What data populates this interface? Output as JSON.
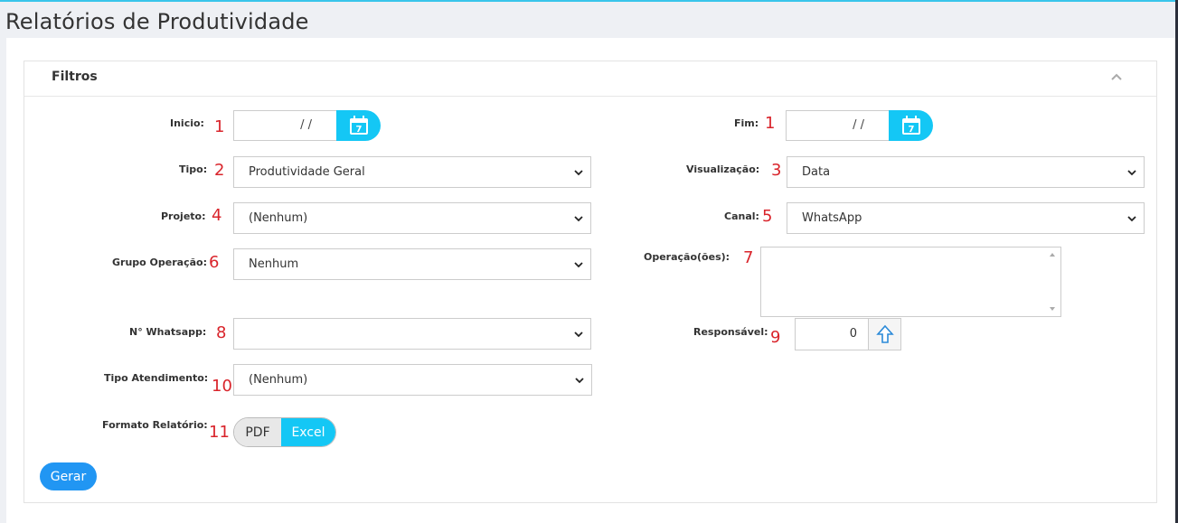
{
  "page": {
    "title": "Relatórios de Produtividade"
  },
  "panel": {
    "title": "Filtros"
  },
  "fields": {
    "inicio": {
      "label": "Inicio:",
      "value": " /  /",
      "num": "1"
    },
    "fim": {
      "label": "Fim:",
      "value": " /  /",
      "num": "1"
    },
    "tipo": {
      "label": "Tipo:",
      "value": "Produtividade Geral",
      "num": "2"
    },
    "visualizacao": {
      "label": "Visualização:",
      "value": "Data",
      "num": "3"
    },
    "projeto": {
      "label": "Projeto:",
      "value": "(Nenhum)",
      "num": "4"
    },
    "canal": {
      "label": "Canal:",
      "value": "WhatsApp",
      "num": "5"
    },
    "grupo_operacao": {
      "label": "Grupo Operação:",
      "value": "Nenhum",
      "num": "6"
    },
    "operacoes": {
      "label": "Operação(ões):",
      "value": "",
      "num": "7"
    },
    "whatsapp": {
      "label": "N° Whatsapp:",
      "value": "",
      "num": "8"
    },
    "responsavel": {
      "label": "Responsável:",
      "value": "0",
      "num": "9"
    },
    "tipo_atendimento": {
      "label": "Tipo Atendimento:",
      "value": "(Nenhum)",
      "num": "10"
    },
    "formato": {
      "label": "Formato Relatório:",
      "options": [
        "PDF",
        "Excel"
      ],
      "selected": "Excel",
      "num": "11"
    }
  },
  "actions": {
    "gerar": "Gerar"
  },
  "colors": {
    "accent": "#14c7f5",
    "primary": "#2196f3",
    "marker": "#d9242b"
  },
  "icons": {
    "calendar": "calendar-icon",
    "collapse": "chevron-up-icon",
    "select": "chevron-down-icon",
    "spinner": "arrow-up-icon"
  }
}
